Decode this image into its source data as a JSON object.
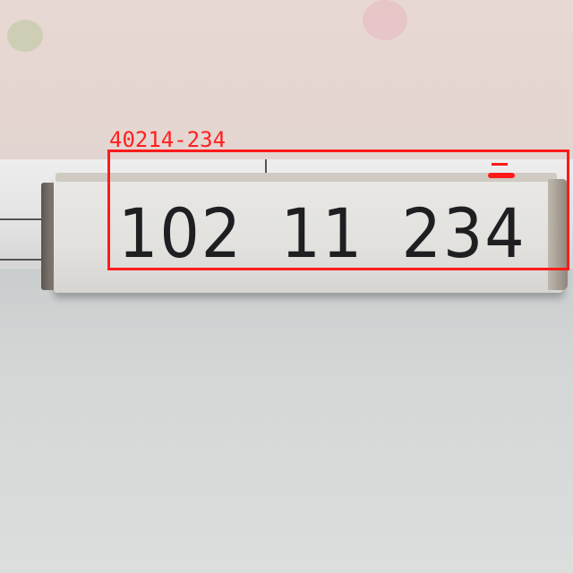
{
  "detection": {
    "label": "40214-234",
    "color": "#ff1a1a"
  },
  "box": {
    "handwritten_text": "102 11 234"
  }
}
